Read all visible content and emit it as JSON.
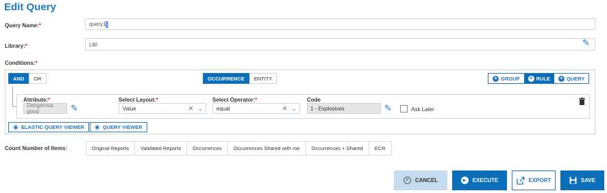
{
  "page": {
    "title": "Edit Query"
  },
  "fields": {
    "query_name": {
      "label": "Query Name:",
      "required": "*",
      "value": "query1"
    },
    "library": {
      "label": "Library:",
      "required": "*",
      "value": "Lib!"
    },
    "conditions": {
      "label": "Conditions:",
      "required": "*"
    }
  },
  "logic_toggle": {
    "and": "AND",
    "or": "OR"
  },
  "scope_toggle": {
    "occurrence": "OCCURRENCE",
    "entity": "ENTITY"
  },
  "add_buttons": {
    "group": "GROUP",
    "rule": "RULE",
    "query": "QUERY"
  },
  "rule": {
    "attribute": {
      "label": "Attribute:",
      "required": "*",
      "value": "Dangerous good"
    },
    "layout": {
      "label": "Select Layout:",
      "required": "*",
      "value": "Value"
    },
    "operator": {
      "label": "Select Operator:",
      "required": "*",
      "value": "equal"
    },
    "code": {
      "label": "Code",
      "value": "1 - Explosives"
    },
    "ask_later": {
      "label": "Ask Later",
      "checked": false
    }
  },
  "viewers": {
    "elastic": "ELASTIC QUERY VIEWER",
    "query": "QUERY VIEWER"
  },
  "count": {
    "label": "Count Number of Items:",
    "tabs": [
      "Original Reports",
      "Validated Reports",
      "Occurrences",
      "Occurrences Shared with me",
      "Occurrences + Shared",
      "ECR"
    ]
  },
  "actions": {
    "cancel": "CANCEL",
    "execute": "EXECUTE",
    "export": "EXPORT",
    "save": "SAVE"
  },
  "icons": {
    "pencil": "pencil-icon",
    "trash": "trash-icon",
    "eye": "eye-icon",
    "clear": "clear-icon",
    "chevron": "chevron-down-icon",
    "plus": "plus-circle-icon",
    "cancel": "cancel-circle-icon",
    "play": "play-icon",
    "export": "export-icon",
    "save": "floppy-disk-icon"
  },
  "colors": {
    "primary": "#0a6eb8",
    "title": "#1a78c2",
    "required": "#d9232d",
    "cancel_bg": "#c5dcef"
  }
}
